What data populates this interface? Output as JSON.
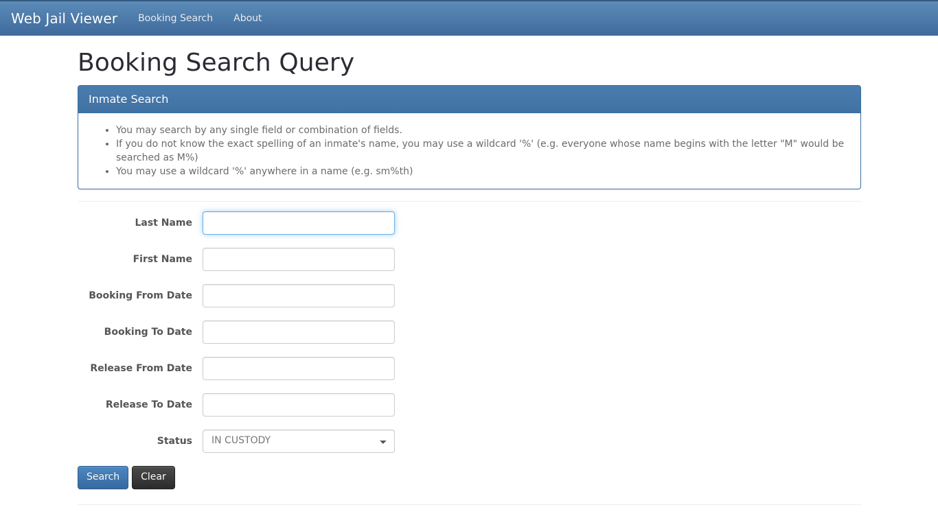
{
  "navbar": {
    "brand": "Web Jail Viewer",
    "links": [
      {
        "label": "Booking Search"
      },
      {
        "label": "About"
      }
    ]
  },
  "page": {
    "title": "Booking Search Query"
  },
  "panel": {
    "title": "Inmate Search",
    "hints": [
      "You may search by any single field or combination of fields.",
      "If you do not know the exact spelling of an inmate's name, you may use a wildcard '%' (e.g. everyone whose name begins with the letter \"M\" would be searched as M%)",
      "You may use a wildcard '%' anywhere in a name (e.g. sm%th)"
    ]
  },
  "form": {
    "fields": [
      {
        "label": "Last Name",
        "value": "",
        "placeholder": ""
      },
      {
        "label": "First Name",
        "value": "",
        "placeholder": ""
      },
      {
        "label": "Booking From Date",
        "value": "",
        "placeholder": ""
      },
      {
        "label": "Booking To Date",
        "value": "",
        "placeholder": ""
      },
      {
        "label": "Release From Date",
        "value": "",
        "placeholder": ""
      },
      {
        "label": "Release To Date",
        "value": "",
        "placeholder": ""
      }
    ],
    "status": {
      "label": "Status",
      "selected": "IN CUSTODY",
      "options": [
        "IN CUSTODY"
      ]
    },
    "buttons": {
      "search": "Search",
      "clear": "Clear"
    }
  },
  "colors": {
    "navbar_top": "#5c8cb8",
    "navbar_bottom": "#3e6a9c",
    "panel_header": "#4477aa",
    "panel_border": "#3c6d9e",
    "focus_border": "#66afe9",
    "primary_button": "#3d77b5",
    "inverse_button": "#363636",
    "label_text": "#555555",
    "hint_text": "#6b6b6b"
  },
  "icons": {
    "select_chevron": "chevron-down-icon"
  }
}
